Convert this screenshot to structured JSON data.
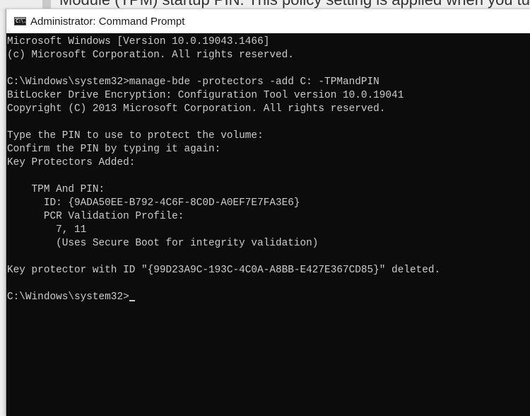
{
  "background_page": {
    "partial_text": "Module (TPM) startup PIN. This policy setting is applied when you turn"
  },
  "window": {
    "title": "Administrator: Command Prompt",
    "icon": "cmd-icon",
    "icon_glyph": "C:\\."
  },
  "console": {
    "lines": [
      "Microsoft Windows [Version 10.0.19043.1466]",
      "(c) Microsoft Corporation. All rights reserved.",
      "",
      "C:\\Windows\\system32>manage-bde -protectors -add C: -TPMandPIN",
      "BitLocker Drive Encryption: Configuration Tool version 10.0.19041",
      "Copyright (C) 2013 Microsoft Corporation. All rights reserved.",
      "",
      "Type the PIN to use to protect the volume:",
      "Confirm the PIN by typing it again:",
      "Key Protectors Added:",
      "",
      "    TPM And PIN:",
      "      ID: {9ADA50EE-B792-4C6F-8C0D-A0EF7E7FA3E6}",
      "      PCR Validation Profile:",
      "        7, 11",
      "        (Uses Secure Boot for integrity validation)",
      "",
      "Key protector with ID \"{99D23A9C-193C-4C0A-A8BB-E427E367CD85}\" deleted.",
      "",
      "C:\\Windows\\system32>"
    ],
    "prompt": "C:\\Windows\\system32>",
    "input_value": ""
  }
}
